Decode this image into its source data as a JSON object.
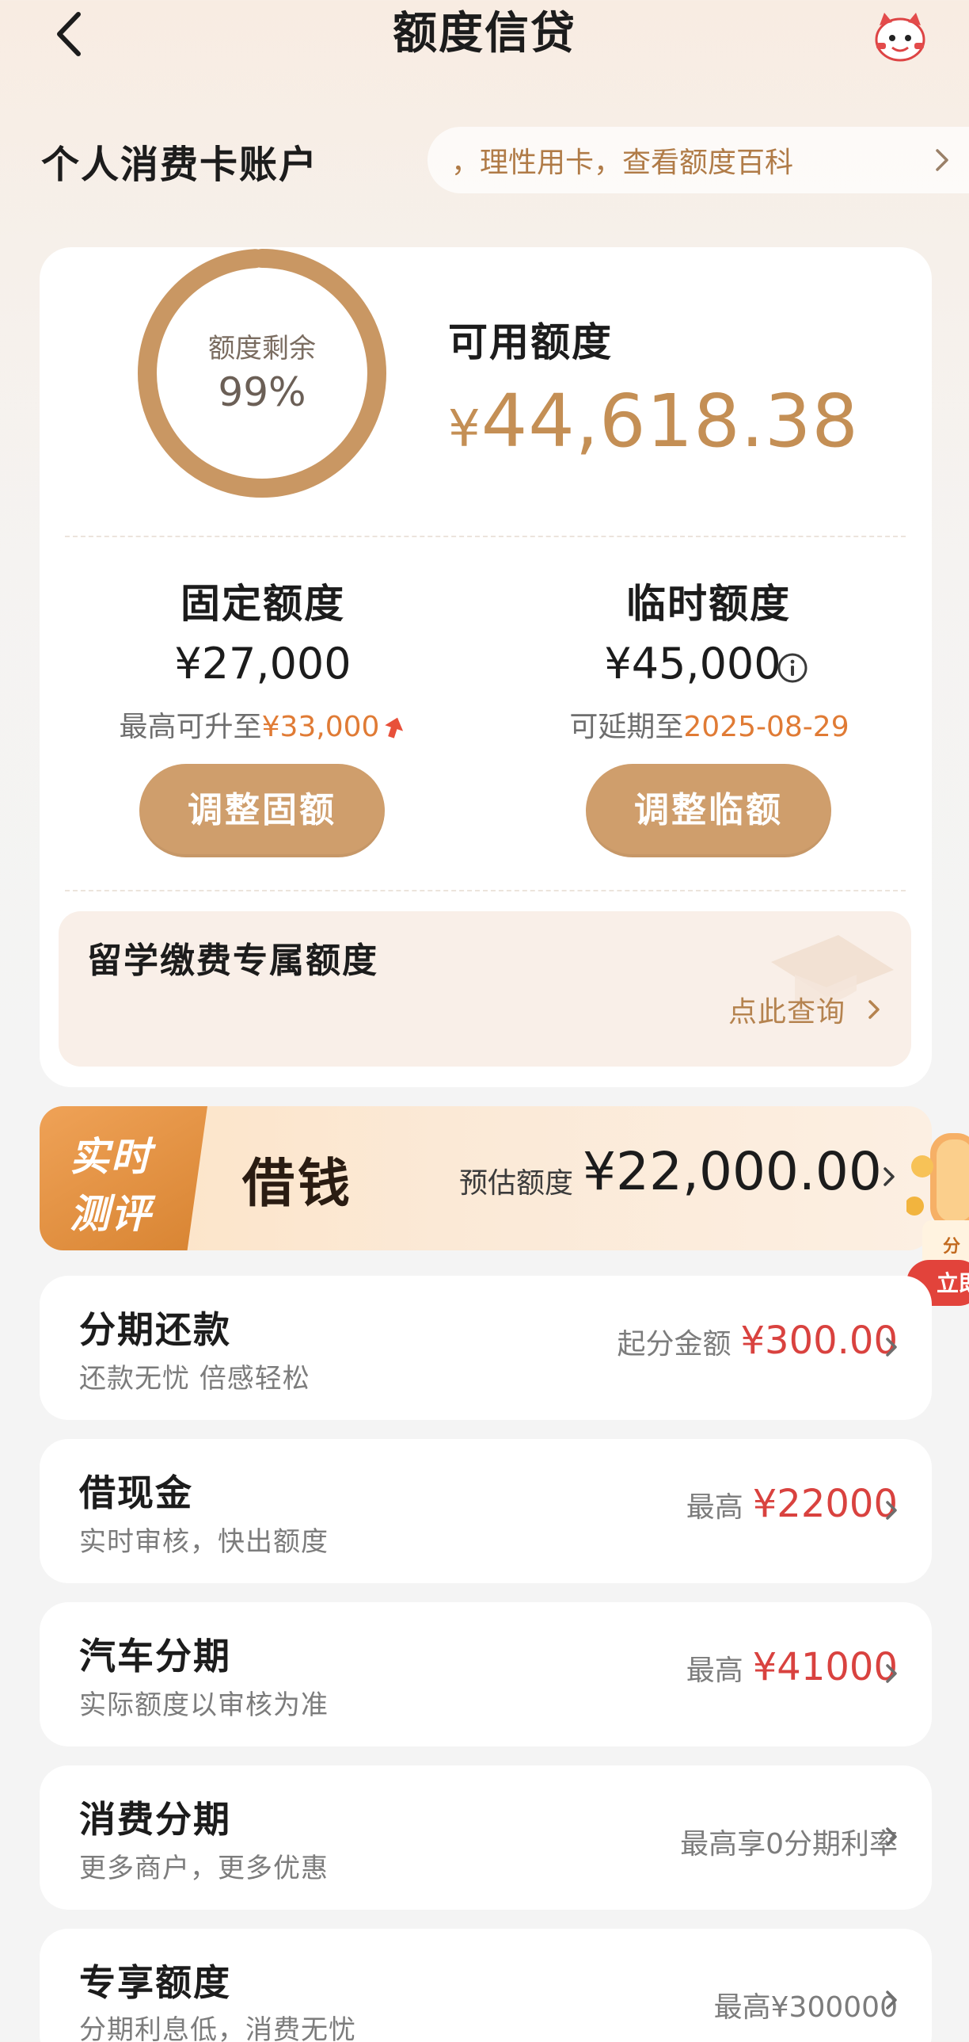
{
  "header": {
    "title": "额度信贷"
  },
  "account": {
    "section_title": "个人消费卡账户",
    "tips_text": "，理性用卡，查看额度百科",
    "ring_label": "额度剩余",
    "ring_percent_text": "99%",
    "remaining_fraction": 0.99,
    "available_label": "可用额度",
    "available_currency": "¥",
    "available_amount": "44,618.38",
    "fixed": {
      "title": "固定额度",
      "amount": "¥27,000",
      "sub_prefix": "最高可升至",
      "sub_value": "¥33,000",
      "button": "调整固额"
    },
    "temporary": {
      "title": "临时额度",
      "amount": "¥45,000",
      "sub_prefix": "可延期至",
      "sub_value": "2025-08-29",
      "button": "调整临额"
    },
    "study": {
      "title": "留学缴费专属额度",
      "link": "点此查询"
    }
  },
  "loan_banner": {
    "tag_line1": "实时",
    "tag_line2": "测评",
    "title": "借钱",
    "estimate_label": "预估额度",
    "estimate_value": "¥22,000.00",
    "float_badge_line1": "分",
    "float_badge_line2": "立即"
  },
  "rows": [
    {
      "title": "分期还款",
      "subtitle": "还款无忧 倍感轻松",
      "right_label": "起分金额",
      "right_amount": "¥300.00"
    },
    {
      "title": "借现金",
      "subtitle": "实时审核，快出额度",
      "right_label": "最高",
      "right_amount": "¥22000"
    },
    {
      "title": "汽车分期",
      "subtitle": "实际额度以审核为准",
      "right_label": "最高",
      "right_amount": "¥41000"
    },
    {
      "title": "消费分期",
      "subtitle": "更多商户，更多优惠",
      "right_label": "最高享0分期利率",
      "right_amount": ""
    },
    {
      "title": "专享额度",
      "subtitle": "分期利息低，消费无忧",
      "right_label": "最高¥300000",
      "right_amount": ""
    }
  ],
  "colors": {
    "accent_gold": "#c48f55",
    "button_gold": "#cf9e6c",
    "highlight_orange": "#e07b35",
    "amount_red": "#d9423f"
  }
}
